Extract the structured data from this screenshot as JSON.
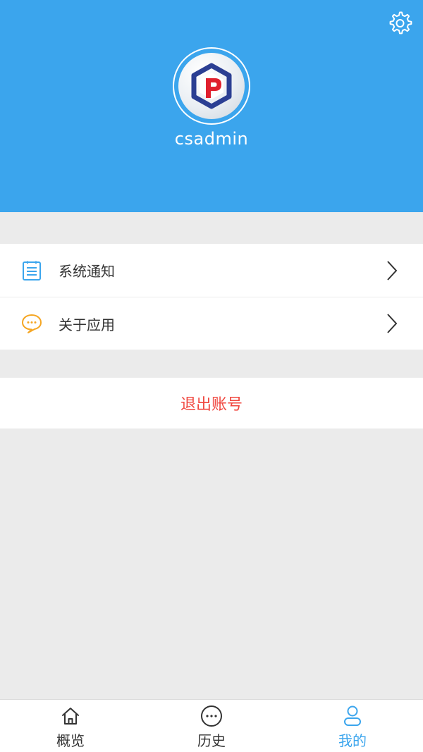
{
  "profile": {
    "username": "csadmin"
  },
  "menu": {
    "items": [
      {
        "label": "系统通知",
        "icon": "notification-list-icon"
      },
      {
        "label": "关于应用",
        "icon": "chat-bubble-icon"
      }
    ]
  },
  "logout": {
    "label": "退出账号"
  },
  "tabbar": {
    "tabs": [
      {
        "label": "概览",
        "icon": "home-icon"
      },
      {
        "label": "历史",
        "icon": "more-circle-icon"
      },
      {
        "label": "我的",
        "icon": "user-icon",
        "active": true
      }
    ]
  },
  "colors": {
    "header": "#3ba5ed",
    "accent": "#3ba5ed",
    "logout": "#f0473f",
    "chat_icon": "#f5a623",
    "background": "#ebebeb"
  }
}
